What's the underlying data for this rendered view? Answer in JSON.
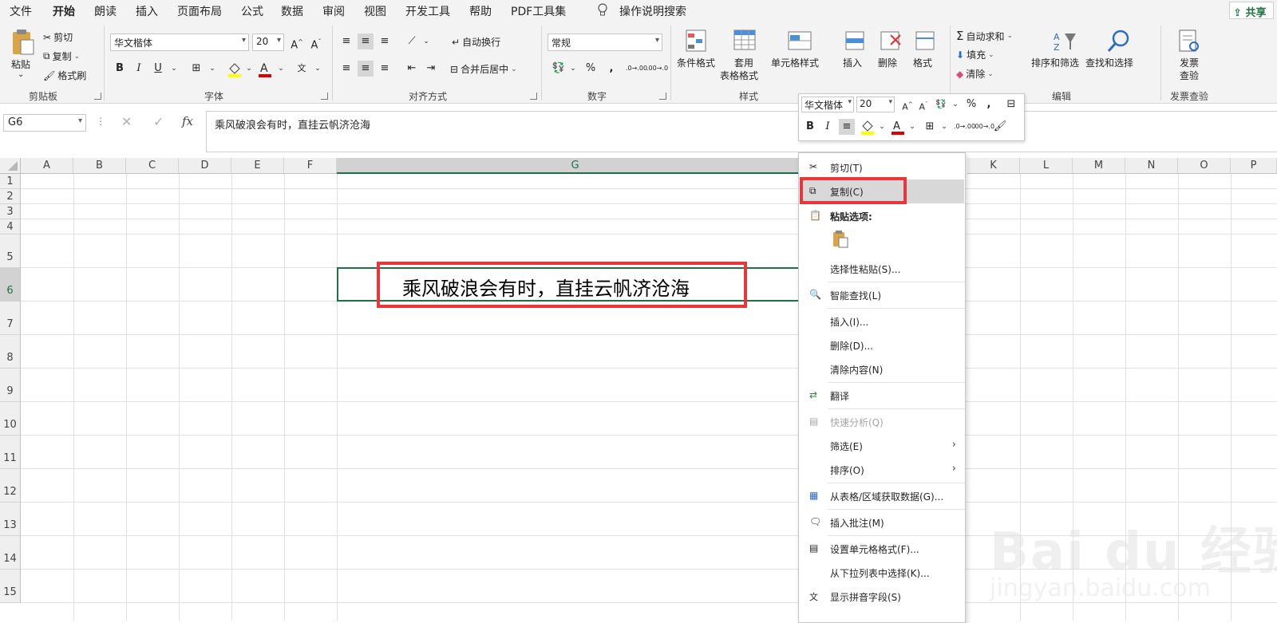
{
  "menu": {
    "tabs": [
      "文件",
      "开始",
      "朗读",
      "插入",
      "页面布局",
      "公式",
      "数据",
      "审阅",
      "视图",
      "开发工具",
      "帮助",
      "PDF工具集"
    ],
    "active_tab": "开始",
    "tell_me": "操作说明搜索",
    "share": "共享"
  },
  "ribbon": {
    "clipboard": {
      "paste": "粘贴",
      "cut": "剪切",
      "copy": "复制",
      "format_painter": "格式刷",
      "label": "剪贴板"
    },
    "font": {
      "family": "华文楷体",
      "size": "20",
      "bold": "B",
      "italic": "I",
      "underline": "U",
      "label": "字体",
      "font_color": "#e00000",
      "fill_color": "#ffff00"
    },
    "alignment": {
      "wrap_text": "自动换行",
      "merge_center": "合并后居中",
      "label": "对齐方式"
    },
    "number": {
      "format": "常规",
      "percent": "%",
      "comma": ",",
      "label": "数字"
    },
    "styles": {
      "conditional": "条件格式",
      "table_format_1": "套用",
      "table_format_2": "表格格式",
      "cell_styles": "单元格样式",
      "label": "样式"
    },
    "cells": {
      "insert": "插入",
      "delete": "删除",
      "format": "格式",
      "label": "单元格"
    },
    "editing": {
      "autosum": "自动求和",
      "fill": "填充",
      "clear": "清除",
      "sort_filter": "排序和筛选",
      "find_select": "查找和选择",
      "label": "编辑"
    },
    "invoice": {
      "line1": "发票",
      "line2": "查验",
      "label": "发票查验"
    }
  },
  "formula_bar": {
    "name_box": "G6",
    "cancel": "✕",
    "enter": "✓",
    "fx": "fx",
    "content": "乘风破浪会有时，直挂云帆济沧海"
  },
  "sheet": {
    "columns": [
      "A",
      "B",
      "C",
      "D",
      "E",
      "F",
      "G",
      "K",
      "L",
      "M",
      "N",
      "O",
      "P"
    ],
    "rows": [
      "1",
      "2",
      "3",
      "4",
      "5",
      "6",
      "7",
      "8",
      "9",
      "10",
      "11",
      "12",
      "13",
      "14",
      "15"
    ],
    "selected_cell_text": "乘风破浪会有时，直挂云帆济沧海"
  },
  "mini_toolbar": {
    "font": "华文楷体",
    "size": "20",
    "percent": "%",
    "comma": ",",
    "bold": "B",
    "italic": "I"
  },
  "context_menu": {
    "items": [
      {
        "label": "剪切(T)",
        "icon": "scissors-icon"
      },
      {
        "label": "复制(C)",
        "icon": "copy-icon"
      },
      {
        "label": "粘贴选项:",
        "icon": "paste-icon"
      },
      {
        "label": "选择性粘贴(S)...",
        "icon": ""
      },
      {
        "label": "智能查找(L)",
        "icon": "smart-lookup-icon"
      },
      {
        "label": "插入(I)...",
        "icon": ""
      },
      {
        "label": "删除(D)...",
        "icon": ""
      },
      {
        "label": "清除内容(N)",
        "icon": ""
      },
      {
        "label": "翻译",
        "icon": "translate-icon"
      },
      {
        "label": "快速分析(Q)",
        "icon": "quick-analysis-icon"
      },
      {
        "label": "筛选(E)",
        "icon": ""
      },
      {
        "label": "排序(O)",
        "icon": ""
      },
      {
        "label": "从表格/区域获取数据(G)...",
        "icon": "table-icon"
      },
      {
        "label": "插入批注(M)",
        "icon": "comment-icon"
      },
      {
        "label": "设置单元格格式(F)...",
        "icon": "format-cells-icon"
      },
      {
        "label": "从下拉列表中选择(K)...",
        "icon": ""
      },
      {
        "label": "显示拼音字段(S)",
        "icon": "phonetic-icon"
      }
    ]
  },
  "watermark": {
    "text": "Bai du 经验",
    "url": "jingyan.baidu.com"
  },
  "colors": {
    "excel_green": "#1e7145",
    "highlight_red": "#e8363a"
  }
}
